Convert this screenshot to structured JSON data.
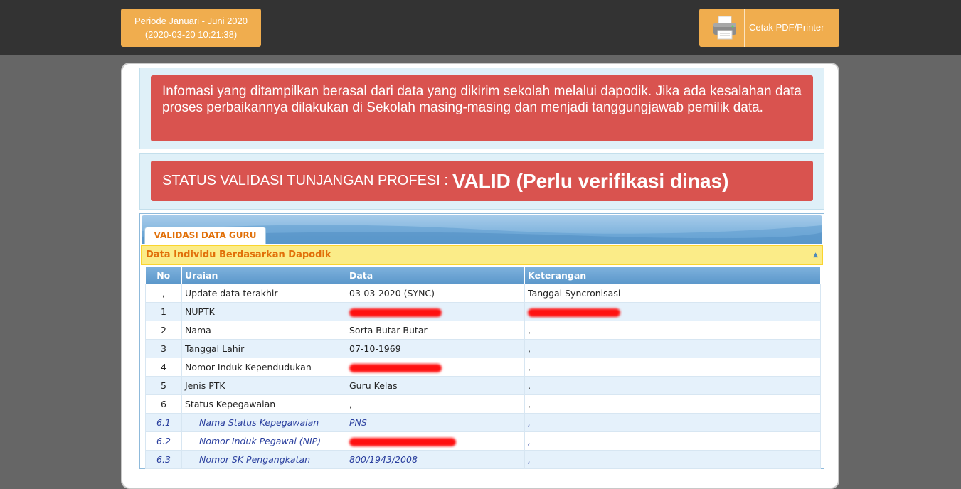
{
  "header": {
    "period_line1": "Periode Januari - Juni 2020",
    "period_line2": "(2020-03-20 10:21:38)",
    "print_label": "Cetak PDF/Printer",
    "print_icon": "printer-icon"
  },
  "info": {
    "message": "Infomasi yang ditampilkan berasal dari data yang dikirim sekolah melalui dapodik. Jika ada kesalahan data proses perbaikannya dilakukan di Sekolah masing-masing dan menjadi tanggungjawab pemilik data."
  },
  "status": {
    "label": "STATUS VALIDASI TUNJANGAN PROFESI :",
    "value": "VALID (Perlu verifikasi dinas)"
  },
  "tabs": [
    {
      "label": "VALIDASI DATA GURU",
      "active": true
    }
  ],
  "section": {
    "title": "Data Individu Berdasarkan Dapodik"
  },
  "table": {
    "headers": [
      "No",
      "Uraian",
      "Data",
      "Keterangan"
    ],
    "rows": [
      {
        "no": ",",
        "uraian": "Update data terakhir",
        "data": "03-03-2020 (SYNC)",
        "keterangan": "Tanggal Syncronisasi"
      },
      {
        "no": "1",
        "uraian": "NUPTK",
        "data": "",
        "keterangan": ""
      },
      {
        "no": "2",
        "uraian": "Nama",
        "data": "Sorta Butar Butar",
        "keterangan": ","
      },
      {
        "no": "3",
        "uraian": "Tanggal Lahir",
        "data": "07-10-1969",
        "keterangan": ","
      },
      {
        "no": "4",
        "uraian": "Nomor Induk Kependudukan",
        "data": "",
        "keterangan": ","
      },
      {
        "no": "5",
        "uraian": "Jenis PTK",
        "data": "Guru Kelas",
        "keterangan": ","
      },
      {
        "no": "6",
        "uraian": "Status Kepegawaian",
        "data": ",",
        "keterangan": ","
      },
      {
        "no": "6.1",
        "uraian": "Nama Status Kepegawaian",
        "data": "PNS",
        "keterangan": ","
      },
      {
        "no": "6.2",
        "uraian": "Nomor Induk Pegawai (NIP)",
        "data": "",
        "keterangan": ","
      },
      {
        "no": "6.3",
        "uraian": "Nomor SK Pengangkatan",
        "data": "800/1943/2008",
        "keterangan": ","
      }
    ]
  },
  "colors": {
    "topbar": "#333333",
    "accent_orange": "#f0ad4e",
    "alert_red": "#d9534f",
    "tab_text": "#e17009",
    "redaction": "#ff1010"
  }
}
